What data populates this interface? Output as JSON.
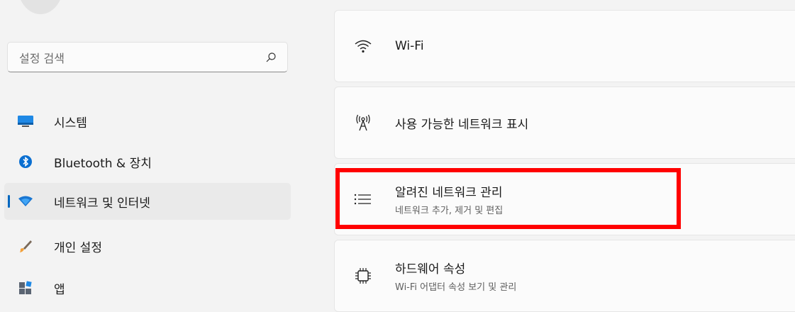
{
  "search": {
    "placeholder": "설정 검색"
  },
  "sidebar": {
    "items": [
      {
        "label": "시스템",
        "icon": "monitor-icon"
      },
      {
        "label": "Bluetooth & 장치",
        "icon": "bluetooth-icon"
      },
      {
        "label": "네트워크 및 인터넷",
        "icon": "network-icon",
        "selected": true
      },
      {
        "label": "개인 설정",
        "icon": "brush-icon"
      },
      {
        "label": "앱",
        "icon": "apps-icon"
      }
    ]
  },
  "cards": [
    {
      "title": "Wi-Fi",
      "icon": "wifi-icon"
    },
    {
      "title": "사용 가능한 네트워크 표시",
      "icon": "antenna-icon"
    },
    {
      "title": "알려진 네트워크 관리",
      "subtitle": "네트워크 추가, 제거 및 편집",
      "icon": "list-icon",
      "highlighted": true
    },
    {
      "title": "하드웨어 속성",
      "subtitle": "Wi-Fi 어댑터 속성 보기 및 관리",
      "icon": "chip-icon"
    }
  ],
  "colors": {
    "accent": "#0067c0",
    "highlight": "#ff0000"
  }
}
